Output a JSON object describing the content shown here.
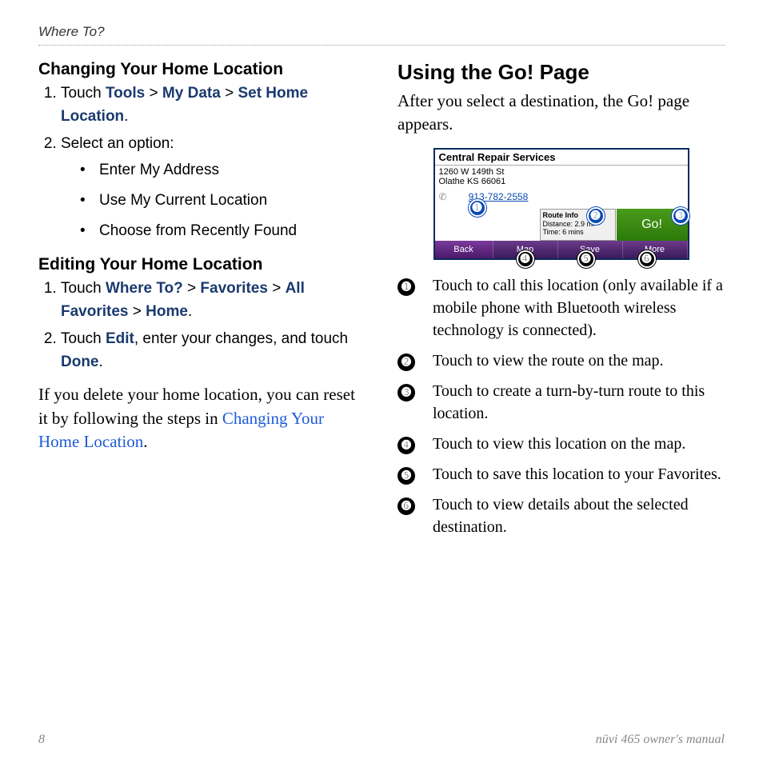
{
  "header": "Where To?",
  "left": {
    "h1": "Changing Your Home Location",
    "steps1": {
      "s1_prefix": "Touch ",
      "nav": [
        "Tools",
        "My Data",
        "Set Home Location"
      ],
      "s2": "Select an option:",
      "bullets": [
        "Enter My Address",
        "Use My Current Location",
        "Choose from Recently Found"
      ]
    },
    "h2": "Editing Your Home Location",
    "steps2": {
      "s1_prefix": "Touch ",
      "nav": [
        "Where To?",
        "Favorites",
        "All Favorites",
        "Home"
      ],
      "s2a": "Touch ",
      "s2b": "Edit",
      "s2c": ", enter your changes, and touch ",
      "s2d": "Done",
      "s2e": "."
    },
    "para_a": "If you delete your home location, you can reset it by following the steps in ",
    "para_link": "Changing Your Home Location",
    "para_b": "."
  },
  "right": {
    "h1": "Using the Go! Page",
    "intro": "After you select a destination, the Go! page appears.",
    "device": {
      "title": "Central Repair Services",
      "addr1": "1260 W 149th St",
      "addr2": "Olathe KS 66061",
      "phone": "913-782-2558",
      "route_title": "Route Info",
      "route_dist": "Distance: 2.9 mi",
      "route_time": "Time: 6 mins",
      "go": "Go!",
      "back": "Back",
      "map": "Map",
      "save": "Save",
      "more": "More"
    },
    "callouts": [
      "➊",
      "➋",
      "➌",
      "➍",
      "➎",
      "➏"
    ],
    "legend": [
      "Touch to call this location (only available if a mobile phone with Bluetooth wireless technology is connected).",
      "Touch to view the route on the map.",
      "Touch to create a turn-by-turn route to this location.",
      "Touch to view this location on the map.",
      "Touch to save this location to your Favorites.",
      "Touch to view details about the selected destination."
    ]
  },
  "footer": {
    "page": "8",
    "book": "nüvi 465 owner's manual"
  }
}
